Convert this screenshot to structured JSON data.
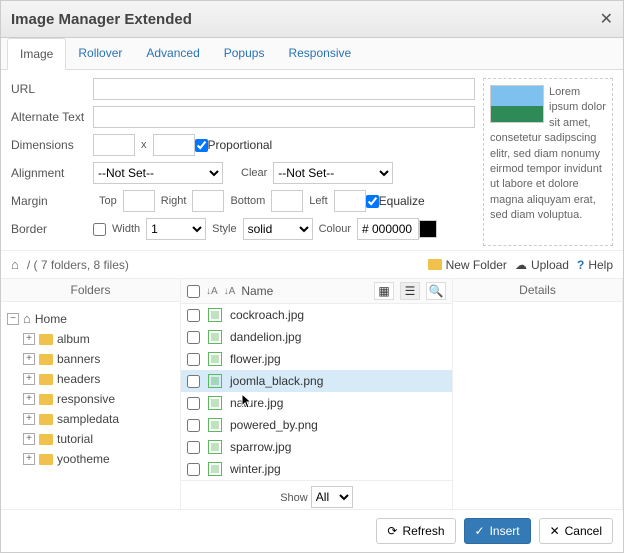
{
  "title": "Image Manager Extended",
  "tabs": [
    "Image",
    "Rollover",
    "Advanced",
    "Popups",
    "Responsive"
  ],
  "activeTab": 0,
  "form": {
    "url_label": "URL",
    "alt_label": "Alternate Text",
    "dim_label": "Dimensions",
    "dim_sep": "x",
    "proportional": "Proportional",
    "align_label": "Alignment",
    "align_value": "--Not Set--",
    "clear_label": "Clear",
    "clear_value": "--Not Set--",
    "margin_label": "Margin",
    "top": "Top",
    "right": "Right",
    "bottom": "Bottom",
    "left": "Left",
    "equalize": "Equalize",
    "border_label": "Border",
    "width": "Width",
    "width_val": "1",
    "style": "Style",
    "style_val": "solid",
    "colour": "Colour",
    "colour_val": "# 000000"
  },
  "preview_text": "Lorem ipsum dolor sit amet, consetetur sadipscing elitr, sed diam nonumy eirmod tempor invidunt ut labore et dolore magna aliquyam erat, sed diam voluptua.",
  "breadcrumb": "/  ( 7 folders, 8 files)",
  "toolbar": {
    "new_folder": "New Folder",
    "upload": "Upload",
    "help": "Help"
  },
  "columns": {
    "folders": "Folders",
    "name": "Name",
    "details": "Details"
  },
  "tree": {
    "root": "Home",
    "children": [
      "album",
      "banners",
      "headers",
      "responsive",
      "sampledata",
      "tutorial",
      "yootheme"
    ]
  },
  "files": [
    {
      "name": "cockroach.jpg"
    },
    {
      "name": "dandelion.jpg"
    },
    {
      "name": "flower.jpg"
    },
    {
      "name": "joomla_black.png",
      "selected": true
    },
    {
      "name": "nature.jpg",
      "cursor": true
    },
    {
      "name": "powered_by.png"
    },
    {
      "name": "sparrow.jpg"
    },
    {
      "name": "winter.jpg"
    }
  ],
  "show": {
    "label": "Show",
    "value": "All"
  },
  "footer": {
    "refresh": "Refresh",
    "insert": "Insert",
    "cancel": "Cancel"
  }
}
